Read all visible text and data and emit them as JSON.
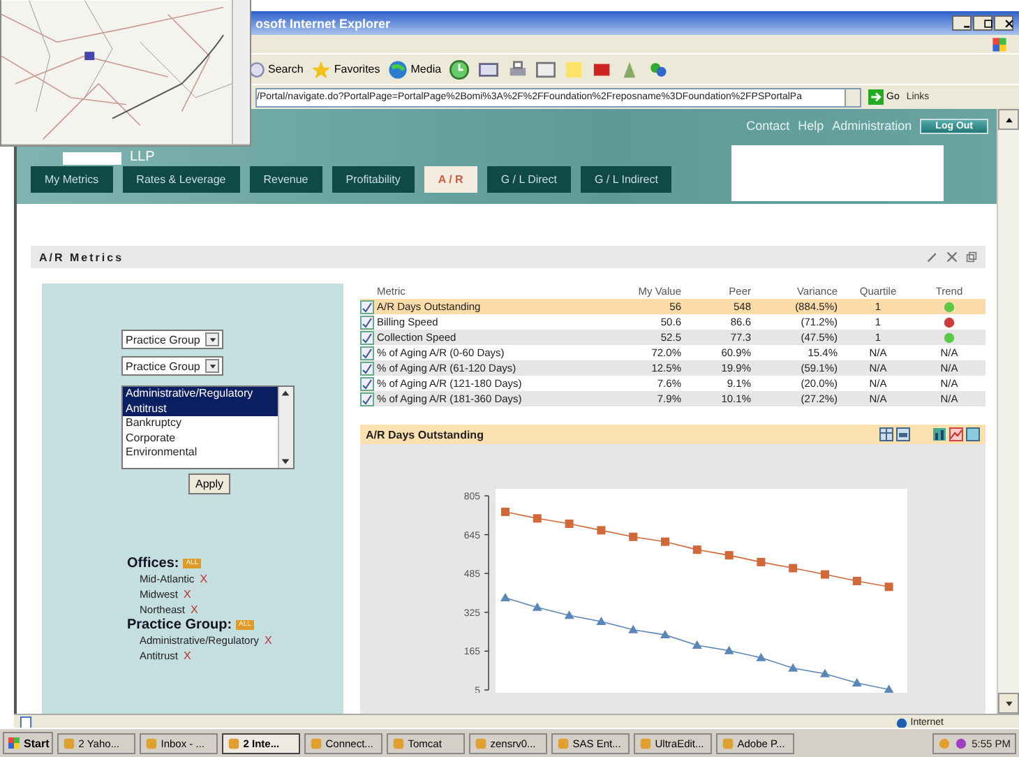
{
  "browser": {
    "title": "osoft Internet Explorer",
    "toolbar": [
      "Search",
      "Favorites",
      "Media"
    ],
    "address": "/Portal/navigate.do?PortalPage=PortalPage%2Bomi%3A%2F%2FFoundation%2Freposname%3DFoundation%2FPSPortalPa",
    "go": "Go",
    "links": "Links",
    "status": "Internet"
  },
  "header": {
    "firm": "LLP",
    "links": [
      "Contact",
      "Help",
      "Administration"
    ],
    "logout": "Log Out"
  },
  "tabs": [
    {
      "label": "My Metrics",
      "selected": false
    },
    {
      "label": "Rates & Leverage",
      "selected": false
    },
    {
      "label": "Revenue",
      "selected": false
    },
    {
      "label": "Profitability",
      "selected": false
    },
    {
      "label": "A / R",
      "selected": true
    },
    {
      "label": "G / L Direct",
      "selected": false
    },
    {
      "label": "G / L Indirect",
      "selected": false
    }
  ],
  "portlet": {
    "title": "A/R Metrics"
  },
  "filters": {
    "select_1": "Practice Group",
    "select_2": "Practice Group",
    "list": [
      {
        "label": "Administrative/Regulatory",
        "selected": true
      },
      {
        "label": "Antitrust",
        "selected": true
      },
      {
        "label": "Bankruptcy",
        "selected": false
      },
      {
        "label": "Corporate",
        "selected": false
      },
      {
        "label": "Environmental",
        "selected": false
      }
    ],
    "apply": "Apply",
    "groups": [
      {
        "title": "Offices:",
        "badge": "ALL",
        "items": [
          {
            "label": "Mid-Atlantic",
            "remove": "X"
          },
          {
            "label": "Midwest",
            "remove": "X"
          },
          {
            "label": "Northeast",
            "remove": "X"
          }
        ]
      },
      {
        "title": "Practice Group:",
        "badge": "ALL",
        "items": [
          {
            "label": "Administrative/Regulatory",
            "remove": "X"
          },
          {
            "label": "Antitrust",
            "remove": "X"
          }
        ]
      }
    ]
  },
  "table": {
    "columns": [
      "Metric",
      "My Value",
      "Peer",
      "Variance",
      "Quartile",
      "Trend"
    ],
    "rows": [
      {
        "metric": "A/R Days Outstanding",
        "my_value": "56",
        "peer": "548",
        "variance": "(884.5%)",
        "quartile": "1",
        "color": "#5cc84a",
        "selected": true
      },
      {
        "metric": "Billing Speed",
        "my_value": "50.6",
        "peer": "86.6",
        "variance": "(71.2%)",
        "quartile": "1",
        "color": "#d03a3a",
        "selected": false
      },
      {
        "metric": "Collection Speed",
        "my_value": "52.5",
        "peer": "77.3",
        "variance": "(47.5%)",
        "quartile": "1",
        "color": "#5cc84a",
        "selected": false
      },
      {
        "metric": "% of Aging A/R (0-60 Days)",
        "my_value": "72.0%",
        "peer": "60.9%",
        "variance": "15.4%",
        "quartile": "N/A",
        "trend_text": "N/A",
        "selected": false
      },
      {
        "metric": "% of Aging A/R (61-120 Days)",
        "my_value": "12.5%",
        "peer": "19.9%",
        "variance": "(59.1%)",
        "quartile": "N/A",
        "trend_text": "N/A",
        "selected": false
      },
      {
        "metric": "% of Aging A/R (121-180 Days)",
        "my_value": "7.6%",
        "peer": "9.1%",
        "variance": "(20.0%)",
        "quartile": "N/A",
        "trend_text": "N/A",
        "selected": false
      },
      {
        "metric": "% of Aging A/R (181-360 Days)",
        "my_value": "7.9%",
        "peer": "10.1%",
        "variance": "(27.2%)",
        "quartile": "N/A",
        "trend_text": "N/A",
        "selected": false
      }
    ]
  },
  "chart_panel": {
    "title": "A/R Days Outstanding",
    "chart_data": {
      "type": "line",
      "yticks": [
        5,
        165,
        325,
        485,
        645,
        805
      ],
      "ylim": [
        5,
        805
      ],
      "series": [
        {
          "color": "#d0683a",
          "marker": "square",
          "values": [
            739,
            712,
            690,
            663,
            636,
            616,
            583,
            560,
            532,
            507,
            481,
            454,
            430
          ]
        },
        {
          "color": "#5b86b8",
          "marker": "triangle",
          "values": [
            385,
            345,
            312,
            287,
            253,
            232,
            189,
            167,
            138,
            95,
            72,
            34,
            7
          ]
        }
      ]
    }
  },
  "taskbar": {
    "start": "Start",
    "items": [
      {
        "label": "2 Yaho...",
        "selected": false
      },
      {
        "label": "Inbox - ...",
        "selected": false
      },
      {
        "label": "2 Inte...",
        "selected": true
      },
      {
        "label": "Connect...",
        "selected": false
      },
      {
        "label": "Tomcat",
        "selected": false
      },
      {
        "label": "zensrv0...",
        "selected": false
      },
      {
        "label": "SAS Ent...",
        "selected": false
      },
      {
        "label": "UltraEdit...",
        "selected": false
      },
      {
        "label": "Adobe P...",
        "selected": false
      }
    ],
    "clock": "5:55 PM"
  }
}
